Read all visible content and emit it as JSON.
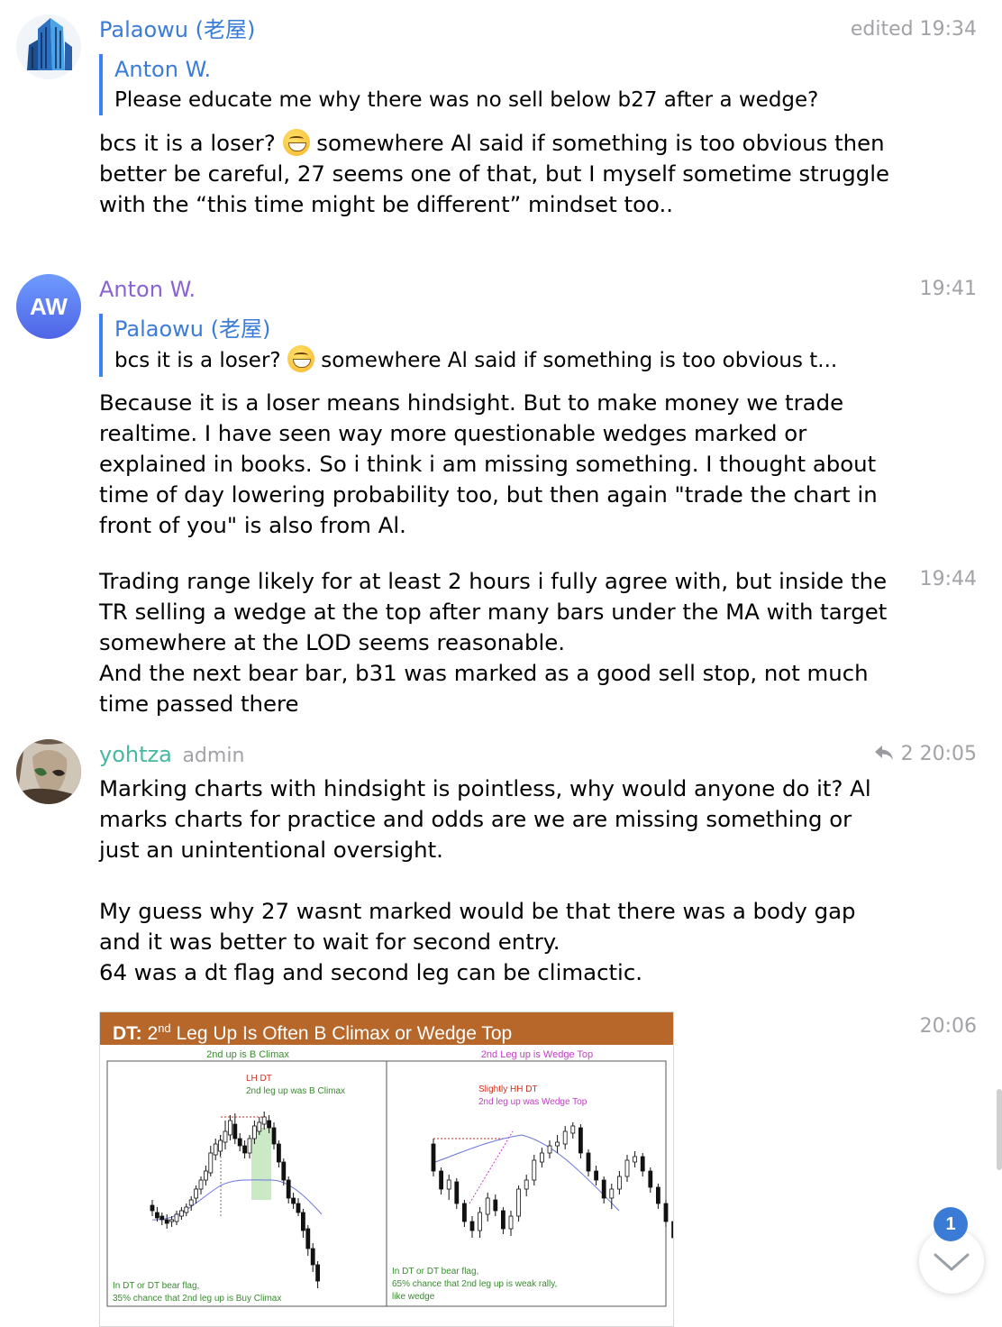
{
  "messages": [
    {
      "sender": "Palaowu (老屋)",
      "time": "edited 19:34",
      "quote_name": "Anton W.",
      "quote_text": "Please educate me why there was no sell below b27 after a wedge?",
      "text_before_emoji": "bcs it is a loser?",
      "text_after_emoji": " somewhere Al said if something is too obvious then better be careful, 27 seems one of that, but I myself sometime struggle with the “this time might be different” mindset too..",
      "sender_color": "#3a7cd6"
    },
    {
      "sender": "Anton W.",
      "avatar_initials": "AW",
      "time": "19:41",
      "quote_name": "Palaowu (老屋)",
      "quote_text_before_emoji": "bcs it is a loser?",
      "quote_text_after_emoji": " somewhere Al said if something is too obvious t...",
      "text": "Because it is a loser means hindsight. But to make money we trade realtime. I have seen way more questionable wedges marked or explained in books. So i think i am missing something. I thought about time of day lowering probability too, but then again \"trade the chart in front of you\" is also from Al.",
      "sender_color": "#8a63d2"
    },
    {
      "time": "19:44",
      "text": "Trading range likely for at least 2 hours i fully agree with, but inside the TR selling a wedge at the top after many bars under the MA with target somewhere at the LOD seems reasonable.\nAnd the next bear bar, b31 was marked as a good sell stop, not much time passed there"
    },
    {
      "sender": "yohtza",
      "role": "admin",
      "reply_count": "2",
      "time": "20:05",
      "text1": "Marking charts with hindsight is pointless, why would anyone do it? Al marks charts for practice and odds are we are missing something or just an unintentional oversight.",
      "text2": "My guess why 27 wasnt marked would be that there was a body gap and it was better to wait for second entry.\n64 was a dt flag and second leg can be climactic.",
      "sender_color": "#47b8a0"
    },
    {
      "time": "20:06"
    }
  ],
  "chart_image": {
    "title_prefix": "DT:",
    "title_nd": "nd",
    "title_rest": " Leg Up Is Often B Climax or Wedge Top",
    "left_heading": "2nd up is B Climax",
    "left_note1": "LH DT",
    "left_note2": "2nd leg up was B Climax",
    "left_footer1": "In DT or DT bear flag,",
    "left_footer2": "35% chance that 2nd leg up is Buy Climax",
    "right_heading": "2nd Leg up is Wedge Top",
    "right_note1": "Slightly HH DT",
    "right_note2": "2nd leg up was Wedge Top",
    "right_footer1": "In DT or DT bear flag,",
    "right_footer2": "65% chance that 2nd leg up is weak rally,",
    "right_footer3": "like wedge"
  },
  "unread_badge": "1",
  "icons": {
    "reply": "reply-arrow-icon",
    "scroll_down": "chevron-down-icon"
  }
}
